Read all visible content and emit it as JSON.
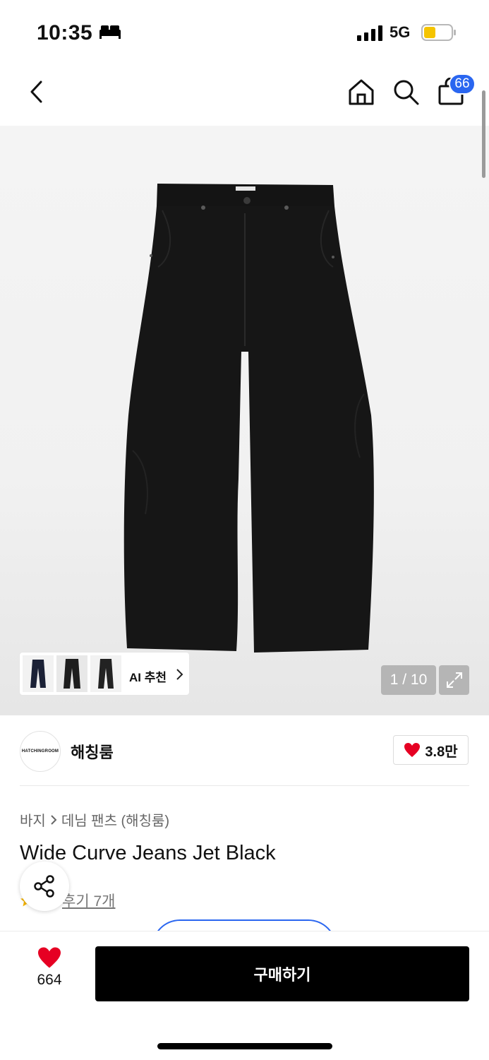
{
  "status_bar": {
    "time": "10:35",
    "network": "5G"
  },
  "header": {
    "cart_count": "66"
  },
  "gallery": {
    "ai_label": "AI 추천",
    "page_indicator": "1 / 10"
  },
  "brand": {
    "logo_text": "HATCHINGROOM",
    "name": "해칭룸",
    "likes": "3.8만"
  },
  "product": {
    "breadcrumb": [
      "바지",
      "데님 팬츠 (해칭룸)"
    ],
    "title": "Wide Curve Jeans Jet Black",
    "reviews": "후기 7개"
  },
  "bottom_bar": {
    "wish_count": "664",
    "buy_label": "구매하기"
  },
  "colors": {
    "accent": "#2a66f0",
    "heart": "#e60023",
    "buy_button": "#000000"
  }
}
